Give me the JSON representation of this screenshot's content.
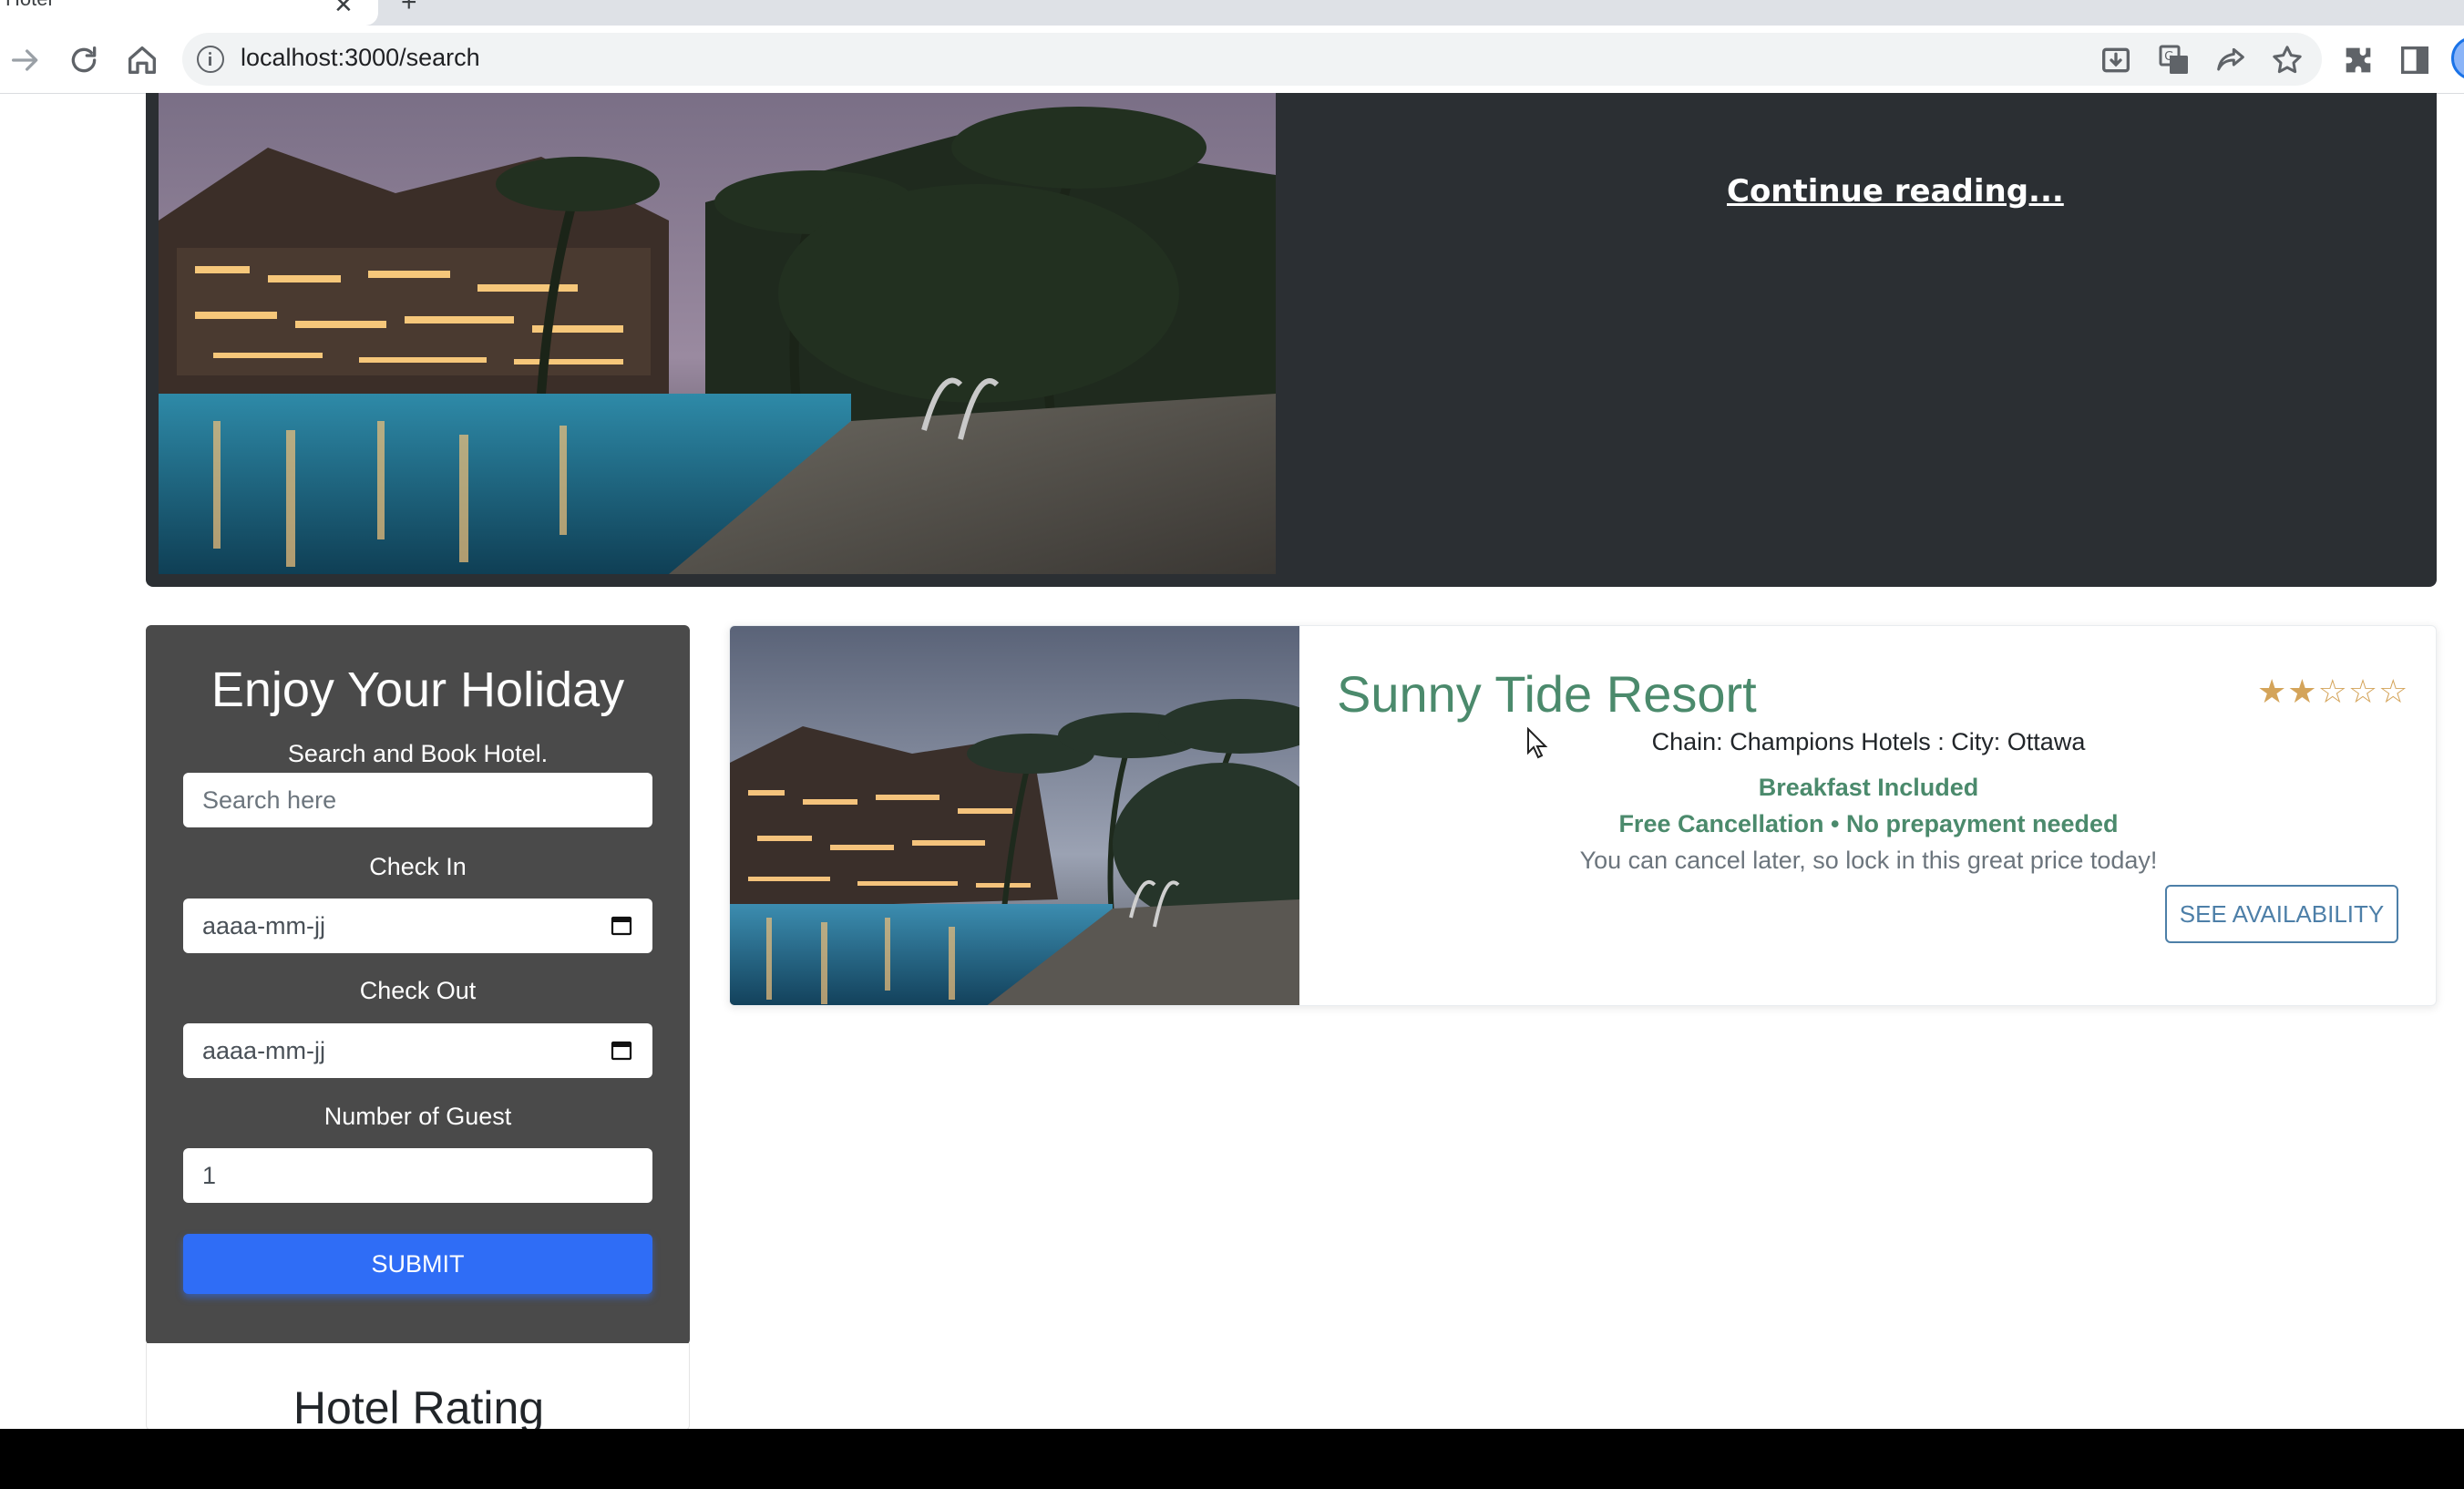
{
  "browser": {
    "tab_title": "Hotel",
    "url": "localhost:3000/search"
  },
  "hero": {
    "continue_link": "Continue reading..."
  },
  "search_panel": {
    "title": "Enjoy Your Holiday",
    "subtitle": "Search and Book Hotel.",
    "search_placeholder": "Search here",
    "check_in_label": "Check In",
    "check_in_value": "aaaa-mm-jj",
    "check_out_label": "Check Out",
    "check_out_value": "aaaa-mm-jj",
    "guests_label": "Number of Guest",
    "guests_value": "1",
    "submit_label": "SUBMIT"
  },
  "rating_panel": {
    "title": "Hotel Rating"
  },
  "results": [
    {
      "name": "Sunny Tide Resort",
      "meta": "Chain: Champions Hotels : City: Ottawa",
      "perk_1": "Breakfast Included",
      "perk_2": "Free Cancellation • No prepayment needed",
      "note": "You can cancel later, so lock in this great price today!",
      "button_label": "SEE AVAILABILITY",
      "rating": 2,
      "rating_max": 5
    }
  ],
  "colors": {
    "accent_green": "#4b8a6c",
    "submit_blue": "#2f6df6",
    "star_gold": "#d4a45a",
    "panel_dark": "#4a4a4a",
    "hero_dark": "#2b2f33"
  },
  "icons": [
    "forward-icon",
    "reload-icon",
    "home-icon",
    "info-icon",
    "install-icon",
    "translate-icon",
    "share-icon",
    "bookmark-star-icon",
    "extensions-icon",
    "side-panel-icon",
    "calendar-icon",
    "star-icon",
    "cursor-icon"
  ]
}
